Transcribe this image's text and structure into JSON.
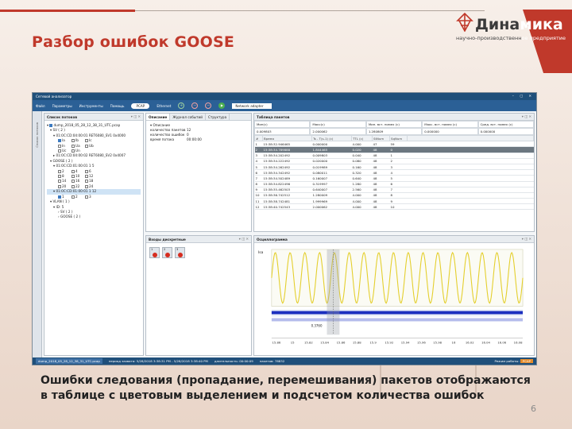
{
  "slide": {
    "title": "Разбор ошибок GOOSE",
    "caption": "Ошибки следования (пропадание, перемешивания) пакетов отображаются в таблице с цветовым выделением и подсчетом количества ошибок",
    "page_number": "6",
    "accent_color": "#c0392b"
  },
  "logo": {
    "word_dark": "Дина",
    "word_light": "мика",
    "sub_dark": "научно-производственн",
    "sub_light": "ое предприятие",
    "mark_icon": "pylon-logo-icon"
  },
  "window": {
    "title": "Сетевой анализатор",
    "controls": "–  ▢  ✕",
    "menu": [
      "Файл",
      "Параметры",
      "Инструменты",
      "Помощь"
    ],
    "mode_toggle": [
      "PCAP",
      "Ethernet"
    ],
    "adapter": "Network adapter",
    "side_tab": "Список потоков"
  },
  "streams_panel": {
    "title": "Список потоков",
    "file": "dump_2018_05_28_12_38_31_UTC.pcap",
    "sv_header": "SV ( 2 )",
    "sv_stream1": "01:0C:CD:04:00:01  RET6080_SV1  0x4000",
    "sv_stream2": "01:0C:CD:04:00:02  RET6080_SV2  0x4007",
    "sv_channels": [
      "Ia",
      "Ib",
      "Ic",
      "In",
      "Ua",
      "Ub",
      "Uc",
      "Un"
    ],
    "goose_header": "GOOSE ( 2 )",
    "goose_stream1": "01:0C:CD:01:00:01  1  5",
    "goose_items1": [
      "2",
      "4",
      "6",
      "8",
      "10",
      "12",
      "14",
      "16",
      "18",
      "20",
      "22",
      "24"
    ],
    "goose_stream2": "01:0C:CD:01:00:01  1  12",
    "goose_items2": [
      "1",
      "2",
      "3"
    ],
    "vlan_header": "VLAN ( 1 )",
    "vlan_id": "ID: 5",
    "vlan_sv": "SV ( 2 )",
    "vlan_goose": "GOOSE ( 2 )"
  },
  "desc_panel": {
    "tabs": [
      "Описание",
      "Журнал событий",
      "Структура"
    ],
    "section": "Описание",
    "rows": [
      {
        "k": "количество пакетов",
        "v": "12"
      },
      {
        "k": "количество ошибок",
        "v": "0"
      },
      {
        "k": "время потока",
        "v": "00:00:00"
      }
    ]
  },
  "inputs_panel": {
    "title": "Входы дискретные",
    "items": [
      "1",
      "2",
      "3"
    ]
  },
  "packets_panel": {
    "title": "Таблица пакетов",
    "filters": [
      "Мин(с)",
      "Макс(с)",
      "Мин. вст. помех (с)",
      "Макс. вст. помех (с)",
      "Сред. вст. помех (с)"
    ],
    "filter_values": [
      "0.009803",
      "2.000062",
      "1.280809",
      "0.000000",
      "0.000000"
    ],
    "columns": [
      "#",
      "Время",
      "Ts - T(s-1) (c)",
      "TTL (c)",
      "StNum",
      "SqNum"
    ],
    "rows": [
      [
        "1",
        "15:38:32.946465",
        "0.000000",
        "4.000",
        "47",
        "59"
      ],
      [
        "2",
        "15:38:34.789888",
        "1.844465",
        "0.020",
        "48",
        "0"
      ],
      [
        "3",
        "15:38:34.202492",
        "0.009803",
        "0.040",
        "48",
        "1"
      ],
      [
        "4",
        "15:38:34.222492",
        "0.020000",
        "0.080",
        "48",
        "2"
      ],
      [
        "5",
        "15:38:34.262492",
        "0.019989",
        "0.160",
        "48",
        "3"
      ],
      [
        "6",
        "15:38:34.342492",
        "0.080011",
        "0.320",
        "48",
        "4"
      ],
      [
        "7",
        "15:38:34.502489",
        "0.160007",
        "0.640",
        "48",
        "5"
      ],
      [
        "8",
        "15:38:34.822496",
        "0.319997",
        "1.280",
        "48",
        "6"
      ],
      [
        "9",
        "15:38:35.462503",
        "0.640007",
        "2.560",
        "48",
        "7"
      ],
      [
        "10",
        "15:38:36.742512",
        "1.280009",
        "4.000",
        "48",
        "8"
      ],
      [
        "11",
        "15:38:38.742481",
        "1.999969",
        "4.000",
        "48",
        "9"
      ],
      [
        "12",
        "15:38:40.742543",
        "2.000062",
        "4.000",
        "48",
        "10"
      ]
    ],
    "error_row_index": 1
  },
  "osc_panel": {
    "title": "Осциллограмма",
    "channel_label": "Isa",
    "cursor_label": "0.3760",
    "x_ticks": [
      "15.86",
      "15",
      "15.82",
      "15.84",
      "15.86",
      "15.88",
      "15.9",
      "15.92",
      "15.94",
      "15.96",
      "15.98",
      "16",
      "16.02",
      "16.04",
      "16.06",
      "16.08"
    ]
  },
  "statusbar": {
    "file": "dump_2018_05_28_12_38_31_UTC.pcap",
    "period": "период захвата: 5/28/2018 3:38:31 PM - 5/28/2018 3:38:40 PM",
    "duration": "длительность: 00:00:09",
    "packets": "пакетов: 78832",
    "mode_label": "Режим работы:",
    "mode_value": "PCAP"
  }
}
